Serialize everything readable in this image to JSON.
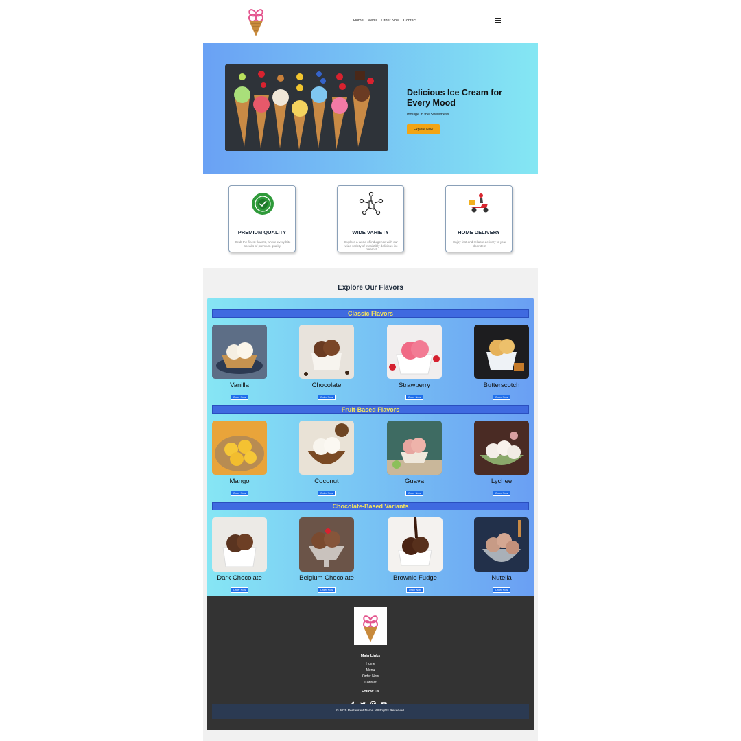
{
  "header": {
    "logo": "ice-cream-cone-logo",
    "nav": [
      "Home",
      "Menu",
      "Order Now",
      "Contact"
    ],
    "menu_icon": "hamburger-icon"
  },
  "hero": {
    "image": "ice-cream-cones-row",
    "title": "Delicious Ice Cream for Every Mood",
    "subtitle": "Indulge in the Sweetness",
    "button": "Explore Now",
    "button_color": "#f2a413"
  },
  "features": [
    {
      "icon": "quality-badge-icon",
      "title": "PREMIUM QUALITY",
      "text": "Grab the finest flavors, where every bite speaks of premium quality!"
    },
    {
      "icon": "variety-network-icon",
      "title": "WIDE VARIETY",
      "text": "Explore a world of indulgence with our wide variety of irresistibly delicious ice creams!"
    },
    {
      "icon": "delivery-scooter-icon",
      "title": "HOME DELIVERY",
      "text": "Enjoy fast and reliable delivery to your doorstep!"
    }
  ],
  "flavors": {
    "heading": "Explore Our Flavors",
    "categories": [
      {
        "title": "Classic Flavors",
        "items": [
          {
            "name": "Vanilla",
            "button": "Order Now"
          },
          {
            "name": "Chocolate",
            "button": "Order Now"
          },
          {
            "name": "Strawberry",
            "button": "Order Now"
          },
          {
            "name": "Butterscotch",
            "button": "Order Now"
          }
        ]
      },
      {
        "title": "Fruit-Based Flavors",
        "items": [
          {
            "name": "Mango",
            "button": "Order Now"
          },
          {
            "name": "Coconut",
            "button": "Order Now"
          },
          {
            "name": "Guava",
            "button": "Order Now"
          },
          {
            "name": "Lychee",
            "button": "Order Now"
          }
        ]
      },
      {
        "title": "Chocolate-Based Variants",
        "items": [
          {
            "name": "Dark Chocolate",
            "button": "Order Now"
          },
          {
            "name": "Belgium Chocolate",
            "button": "Order Now"
          },
          {
            "name": "Brownie Fudge",
            "button": "Order Now"
          },
          {
            "name": "Nutella",
            "button": "Order Now"
          }
        ]
      }
    ]
  },
  "footer": {
    "main_links_title": "Main Links",
    "links": [
      "Home",
      "Menu",
      "Order Now",
      "Contact"
    ],
    "follow_title": "Follow Us",
    "social": [
      "facebook-icon",
      "twitter-icon",
      "instagram-icon",
      "youtube-icon"
    ],
    "copyright": "© 2025 Restaurant Name. All Rights Reserved."
  },
  "colors": {
    "accent": "#f2a413",
    "order_button": "#1f6feb",
    "category_bar": "#3f6ae0",
    "category_text": "#f6e45b",
    "footer": "#333333"
  }
}
